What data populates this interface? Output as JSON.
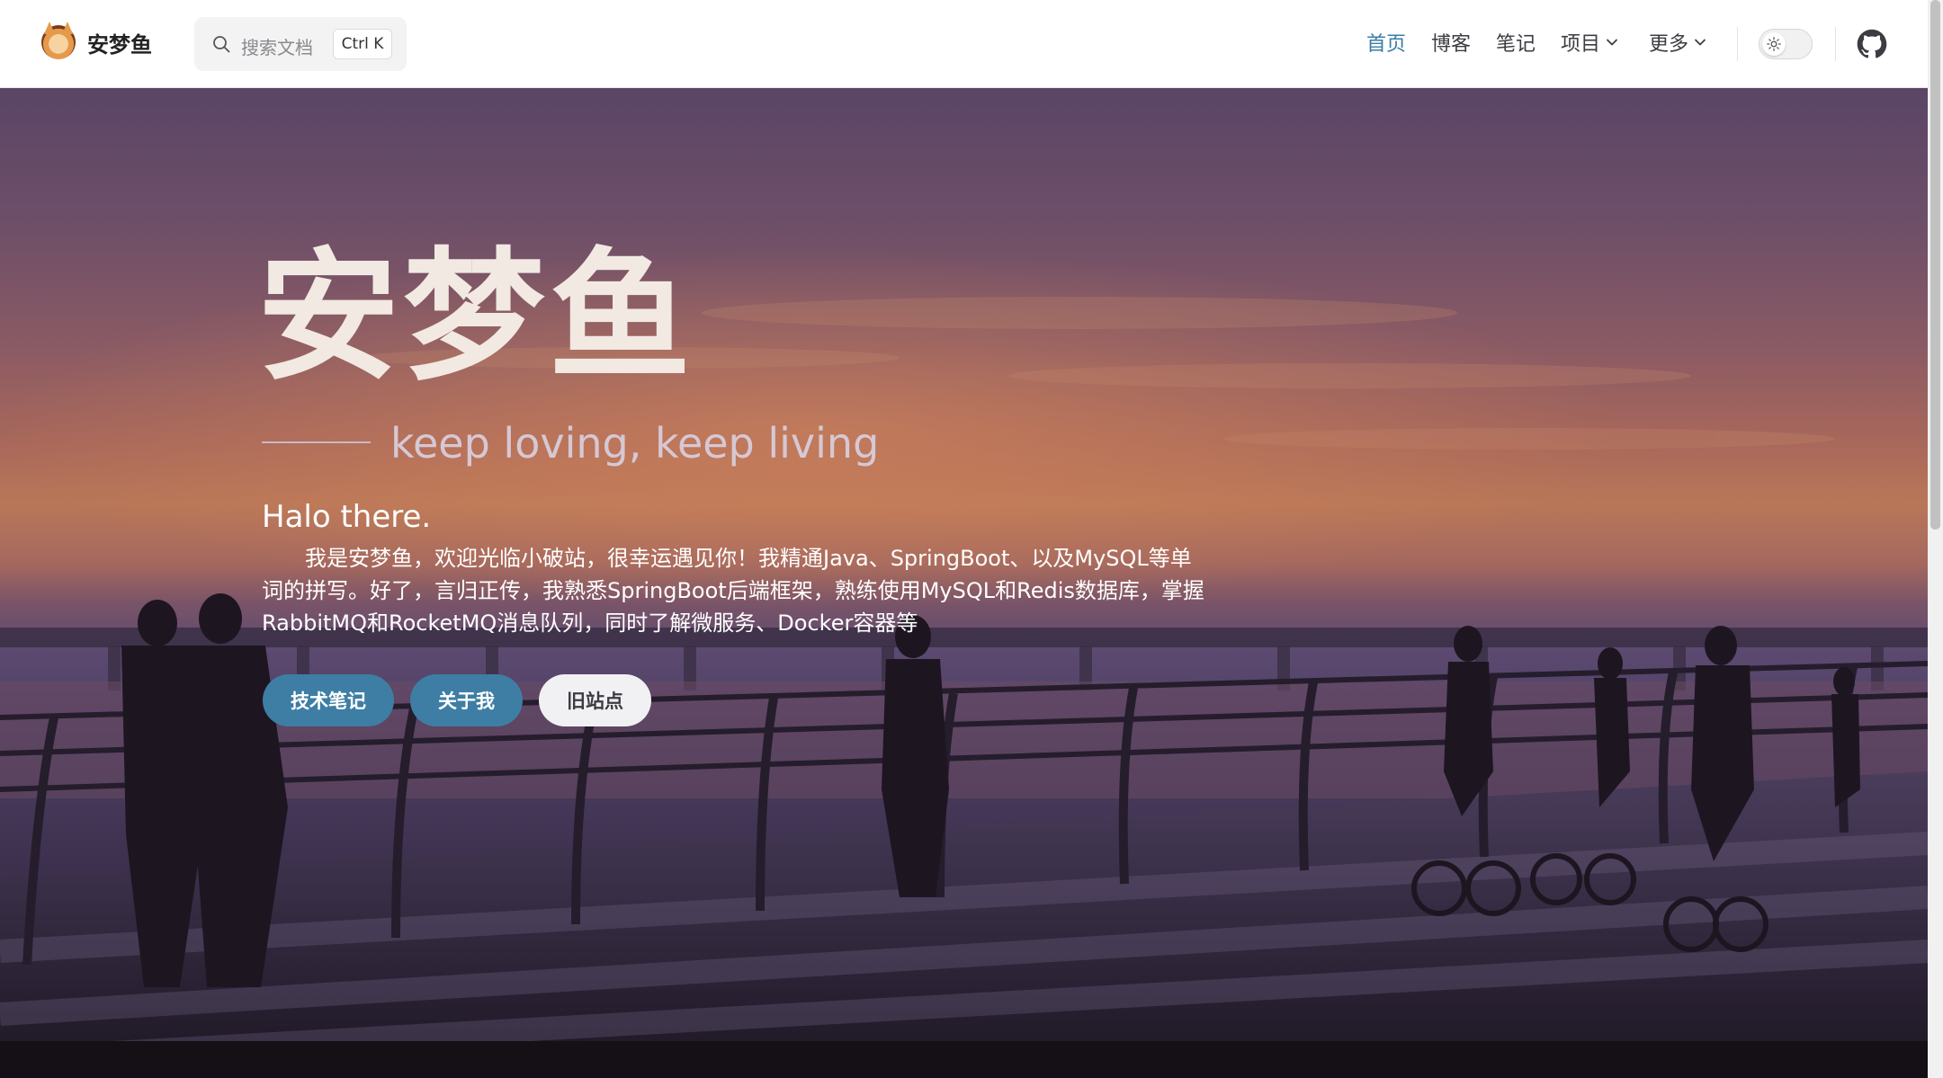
{
  "navbar": {
    "brand_name": "安梦鱼",
    "search_placeholder": "搜索文档",
    "search_shortcut": "Ctrl K",
    "links": [
      {
        "label": "首页",
        "active": true
      },
      {
        "label": "博客"
      },
      {
        "label": "笔记"
      },
      {
        "label": "项目",
        "dropdown": true
      },
      {
        "label": "更多",
        "dropdown": true
      }
    ],
    "theme_toggle_icon": "sun-icon",
    "github_icon": "github-icon"
  },
  "hero": {
    "title": "安梦鱼",
    "tagline": "keep loving, keep living",
    "greeting": "Halo there.",
    "intro": "我是安梦鱼，欢迎光临小破站，很幸运遇见你！我精通Java、SpringBoot、以及MySQL等单词的拼写。好了，言归正传，我熟悉SpringBoot后端框架，熟练使用MySQL和Redis数据库，掌握RabbitMQ和RocketMQ消息队列，同时了解微服务、Docker容器等",
    "buttons": [
      {
        "label": "技术笔记",
        "style": "primary"
      },
      {
        "label": "关于我",
        "style": "primary"
      },
      {
        "label": "旧站点",
        "style": "light"
      }
    ]
  },
  "colors": {
    "accent": "#3a7ca5",
    "button_primary": "#3e7ea4",
    "button_light": "#f1f1f4"
  }
}
